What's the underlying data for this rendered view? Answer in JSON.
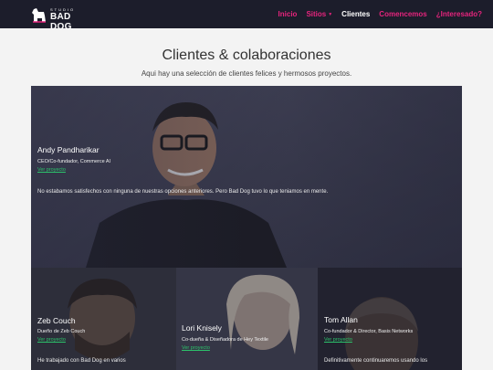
{
  "brand": {
    "small": "STUDIO",
    "big": "BAD DOG"
  },
  "nav": [
    {
      "label": "Inicio"
    },
    {
      "label": "Sitios"
    },
    {
      "label": "Clientes"
    },
    {
      "label": "Comencemos"
    },
    {
      "label": "¿Interesado?"
    }
  ],
  "colors": {
    "nav_bg": "#1c1d2b",
    "accent": "#e6247d",
    "link": "#2cc36b"
  },
  "header": {
    "title": "Clientes & colaboraciones",
    "subtitle": "Aqui hay una selección de clientes felices y hermosos proyectos."
  },
  "clients": [
    {
      "name": "Andy Pandharikar",
      "role": "CEO/Co-fundador, Commerce AI",
      "link": "Ver proyecto",
      "quote": "No estabamos satisfechos con ninguna de nuestras opciones anteriores. Pero Bad Dog tuvo lo que teniamos en mente."
    },
    {
      "name": "Zeb Couch",
      "role": "Dueño de Zeb Couch",
      "link": "Ver proyecto",
      "quote": "He trabajado con Bad Dog en varios"
    },
    {
      "name": "Lori Knisely",
      "role": "Co-dueña & Diseñadora de Hey Textile",
      "link": "Ver proyecto",
      "quote": ""
    },
    {
      "name": "Tom Allan",
      "role": "Co-fundador & Director, Basis Networks",
      "link": "Ver proyecto",
      "quote": "Definitivamente continuaremos usando los"
    }
  ]
}
